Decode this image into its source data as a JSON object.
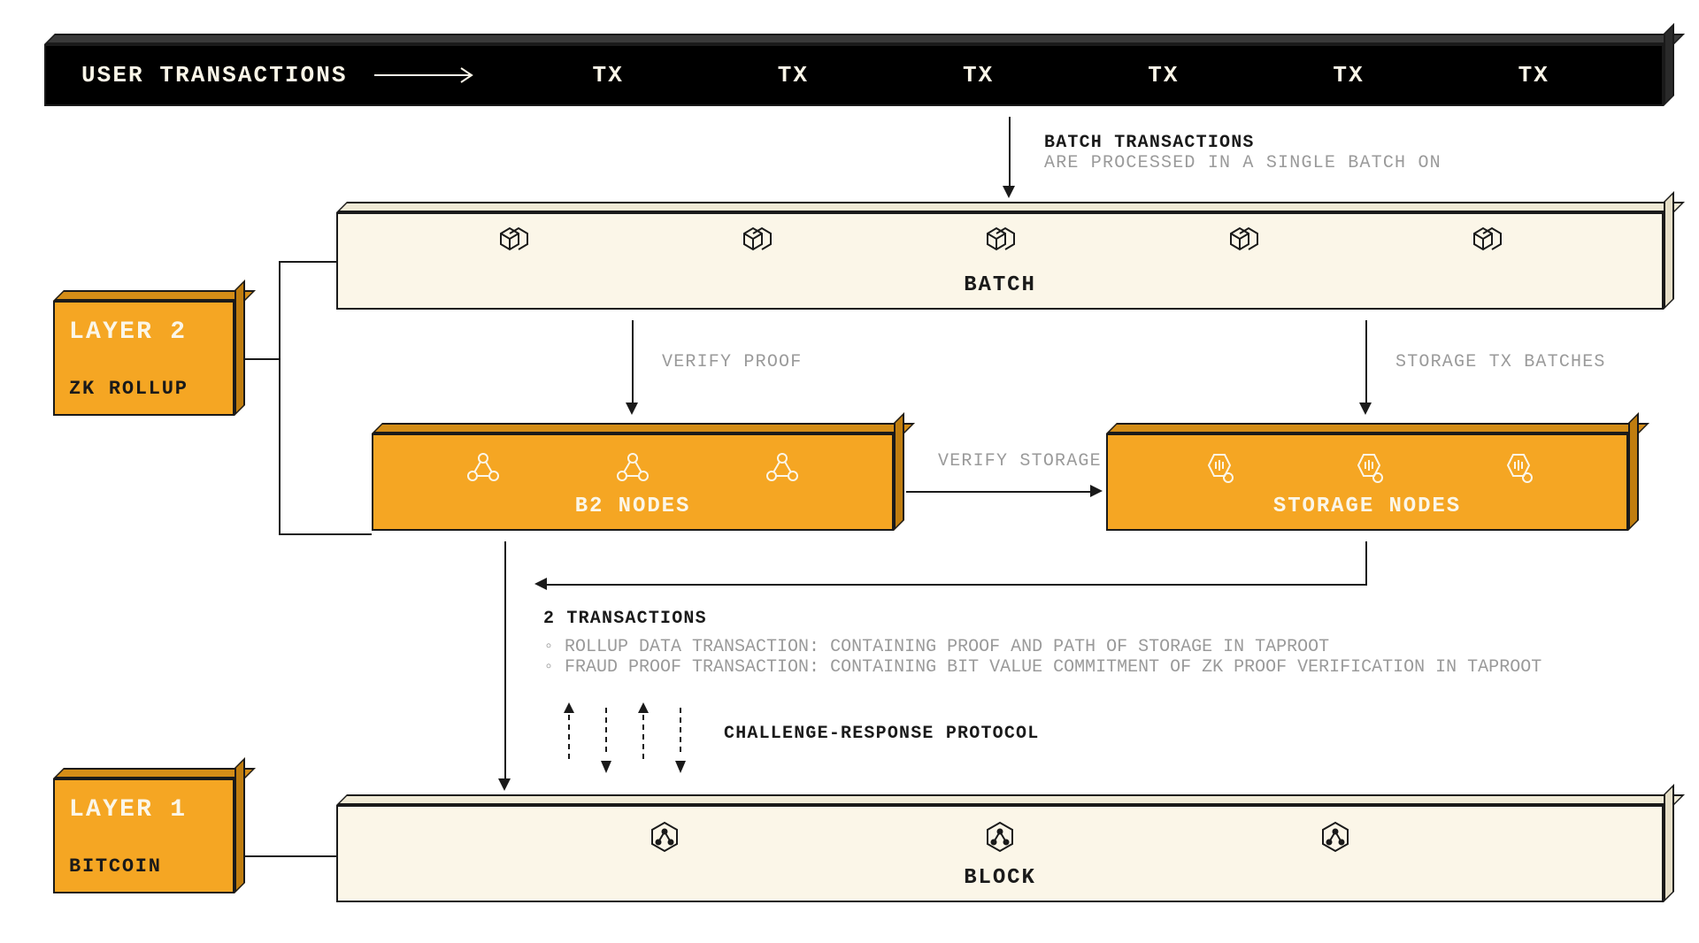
{
  "top_bar": {
    "title": "USER TRANSACTIONS",
    "tx_label": "TX",
    "tx_count": 6
  },
  "batch_annot": {
    "bold": "BATCH TRANSACTIONS",
    "grey": "ARE PROCESSED IN A SINGLE BATCH ON"
  },
  "batch_bar": {
    "label": "BATCH"
  },
  "layer2": {
    "title": "LAYER 2",
    "sub": "ZK ROLLUP"
  },
  "verify_proof": "VERIFY PROOF",
  "storage_tx": "STORAGE TX BATCHES",
  "b2_nodes": {
    "label": "B2 NODES"
  },
  "storage_nodes": {
    "label": "STORAGE NODES"
  },
  "verify_storage": "VERIFY STORAGE",
  "two_tx": {
    "bold": "2 TRANSACTIONS",
    "bullets": [
      "ROLLUP DATA TRANSACTION: CONTAINING PROOF AND PATH OF STORAGE IN TAPROOT",
      "FRAUD PROOF TRANSACTION: CONTAINING BIT VALUE COMMITMENT OF ZK PROOF VERIFICATION IN TAPROOT"
    ]
  },
  "challenge": "CHALLENGE-RESPONSE PROTOCOL",
  "layer1": {
    "title": "LAYER 1",
    "sub": "BITCOIN"
  },
  "block_bar": {
    "label": "BLOCK"
  },
  "colors": {
    "black": "#000000",
    "orange": "#f5a623",
    "cream": "#fbf6e8"
  }
}
